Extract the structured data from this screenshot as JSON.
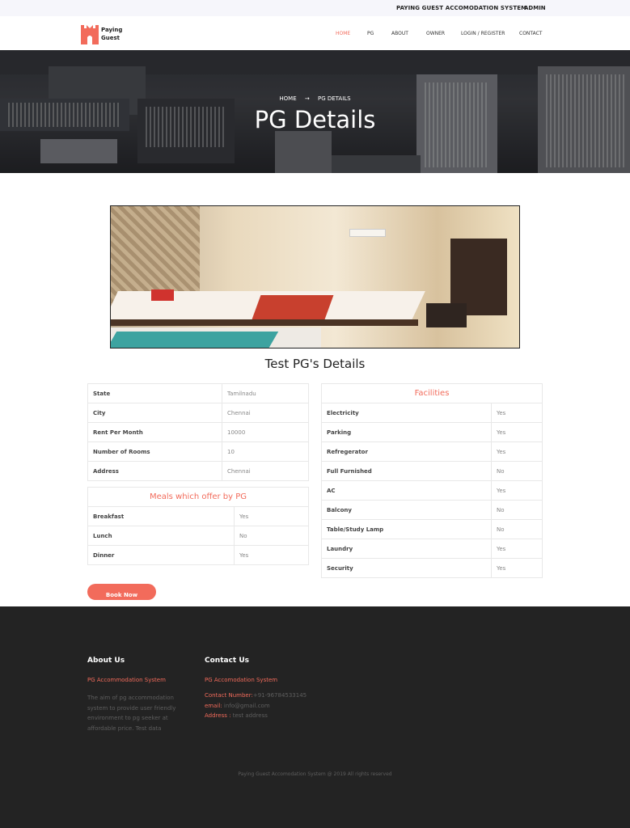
{
  "topbar": {
    "title": "PAYING GUEST ACCOMODATION SYSTEM",
    "admin": "ADMIN"
  },
  "logo": {
    "line1": "Paying",
    "line2": "Guest"
  },
  "nav": {
    "items": [
      "HOME",
      "PG",
      "ABOUT",
      "OWNER",
      "LOGIN / REGISTER",
      "CONTACT"
    ],
    "active": "HOME"
  },
  "hero": {
    "breadcrumb_home": "HOME",
    "breadcrumb_arrow": "→",
    "breadcrumb_current": "PG DETAILS",
    "title": "PG Details"
  },
  "details_title": "Test PG's Details",
  "info_rows": [
    {
      "label": "State",
      "value": "Tamilnadu"
    },
    {
      "label": "City",
      "value": "Chennai"
    },
    {
      "label": "Rent Per Month",
      "value": "10000"
    },
    {
      "label": "Number of Rooms",
      "value": "10"
    },
    {
      "label": "Address",
      "value": "Chennai"
    }
  ],
  "meals": {
    "title": "Meals which offer by PG",
    "rows": [
      {
        "label": "Breakfast",
        "value": "Yes"
      },
      {
        "label": "Lunch",
        "value": "No"
      },
      {
        "label": "Dinner",
        "value": "Yes"
      }
    ]
  },
  "facilities": {
    "title": "Facilities",
    "rows": [
      {
        "label": "Electricity",
        "value": "Yes"
      },
      {
        "label": "Parking",
        "value": "Yes"
      },
      {
        "label": "Refregerator",
        "value": "Yes"
      },
      {
        "label": "Full Furnished",
        "value": "No"
      },
      {
        "label": "AC",
        "value": "Yes"
      },
      {
        "label": "Balcony",
        "value": "No"
      },
      {
        "label": "Table/Study Lamp",
        "value": "No"
      },
      {
        "label": "Laundry",
        "value": "Yes"
      },
      {
        "label": "Security",
        "value": "Yes"
      }
    ]
  },
  "book_button": "Book Now",
  "footer": {
    "about_heading": "About Us",
    "about_sub": "PG Accommodation System",
    "about_text": "The aim of pg accommodation system to provide user friendly environment to pg seeker at affordable price. Test data",
    "contact_heading": "Contact Us",
    "contact_sub": "PG Accomodation System",
    "contact_number_label": "Contact Number:",
    "contact_number": "+91-96784533145",
    "email_label": "email:",
    "email": " info@gmail.com",
    "address_label": "Address :",
    "address": " test address",
    "copyright": "Paying Guest Accomodation System @ 2019 All rights reserved"
  },
  "colors": {
    "accent": "#f26b5b",
    "footer_bg": "#232323"
  }
}
